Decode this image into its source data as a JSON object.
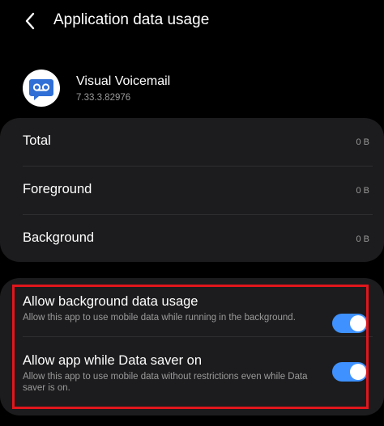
{
  "header": {
    "title": "Application data usage"
  },
  "app": {
    "name": "Visual Voicemail",
    "version": "7.33.3.82976",
    "icon": "voicemail-icon",
    "icon_color": "#2f6fd6"
  },
  "usage": {
    "rows": [
      {
        "label": "Total",
        "value": "0 B"
      },
      {
        "label": "Foreground",
        "value": "0 B"
      },
      {
        "label": "Background",
        "value": "0 B"
      }
    ]
  },
  "settings": {
    "items": [
      {
        "title": "Allow background data usage",
        "description": "Allow this app to use mobile data while running in the background.",
        "enabled": true
      },
      {
        "title": "Allow app while Data saver on",
        "description": "Allow this app to use mobile data without restrictions even while Data saver is on.",
        "enabled": true
      }
    ]
  },
  "colors": {
    "background": "#000000",
    "card": "#1c1c1e",
    "toggle_on": "#3e91ff",
    "highlight": "#e0161c"
  }
}
